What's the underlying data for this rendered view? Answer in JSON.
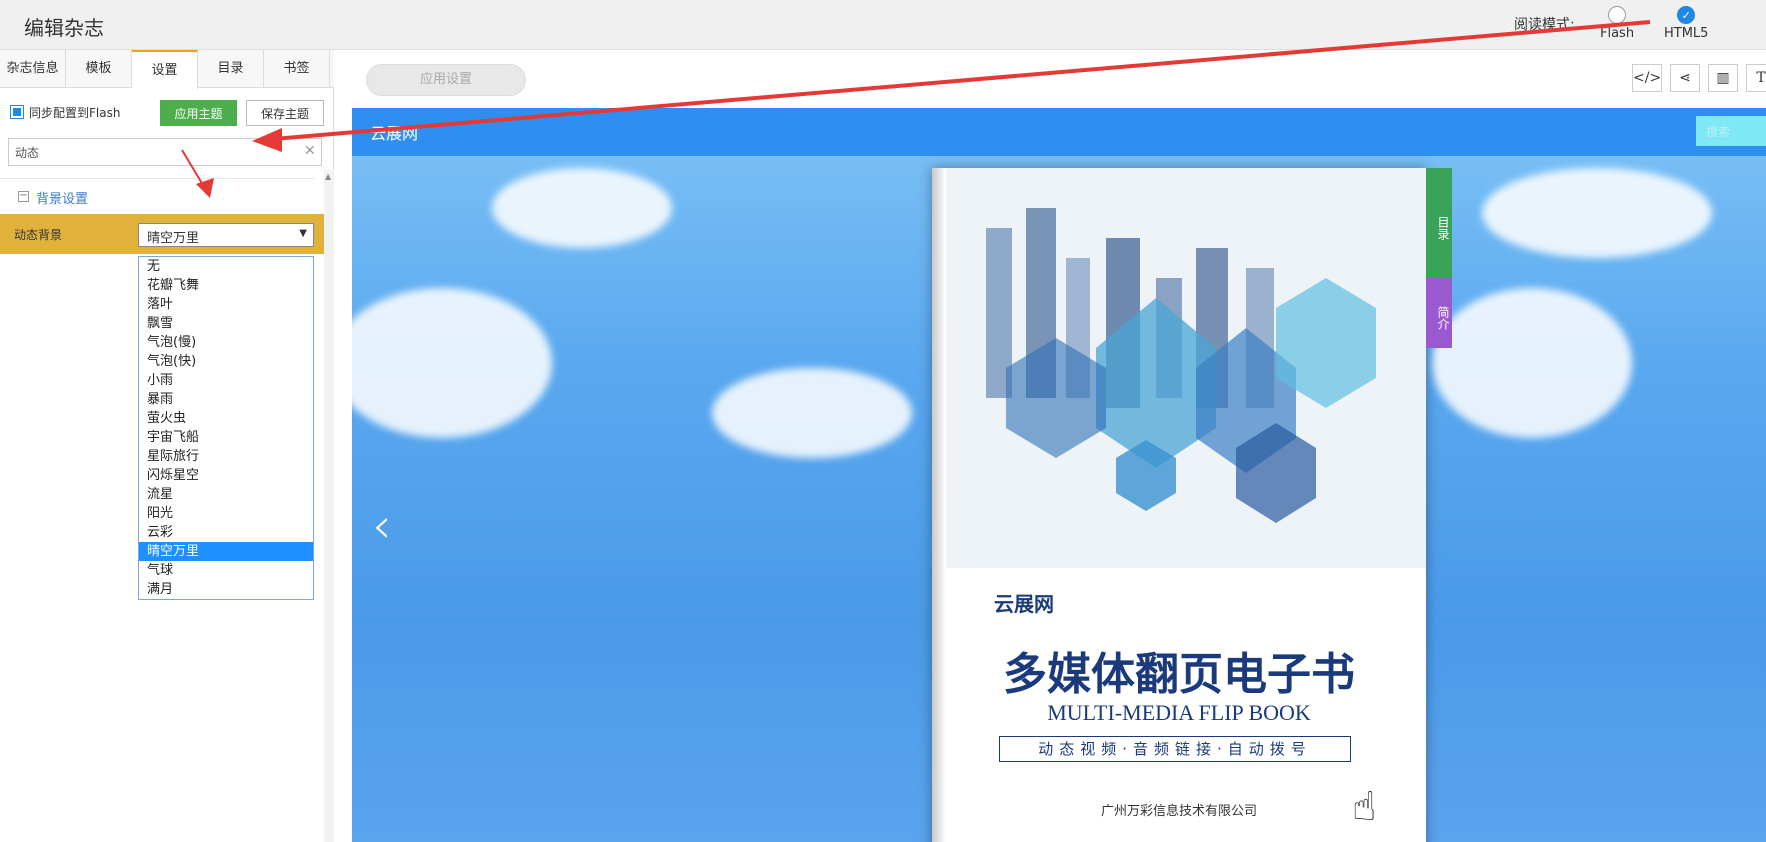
{
  "app": {
    "title": "编辑杂志"
  },
  "read_mode": {
    "label": "阅读模式:",
    "options": [
      {
        "label": "Flash",
        "selected": false
      },
      {
        "label": "HTML5",
        "selected": true
      }
    ]
  },
  "tabs": [
    "杂志信息",
    "模板",
    "设置",
    "目录",
    "书签"
  ],
  "active_tab": "设置",
  "settings": {
    "sync_label": "同步配置到Flash",
    "apply_theme": "应用主题",
    "save_theme": "保存主题",
    "search_value": "动态",
    "section_title": "背景设置",
    "prop_label": "动态背景",
    "selected_value": "晴空万里",
    "options": [
      "无",
      "花瓣飞舞",
      "落叶",
      "飘雪",
      "气泡(慢)",
      "气泡(快)",
      "小雨",
      "暴雨",
      "萤火虫",
      "宇宙飞船",
      "星际旅行",
      "闪烁星空",
      "流星",
      "阳光",
      "云彩",
      "晴空万里",
      "气球",
      "满月"
    ]
  },
  "content": {
    "apply_settings": "应用设置",
    "tool_icons": [
      "code-icon",
      "share-icon",
      "layout-icon",
      "text-icon",
      "download-icon"
    ],
    "preview": {
      "logo": "云展网",
      "search_placeholder": "搜索",
      "side_tabs": [
        "目录",
        "简介"
      ],
      "book": {
        "logo": "云展网",
        "title": "多媒体翻页电子书",
        "subtitle": "MULTI-MEDIA FLIP BOOK",
        "tagline": "动态视频·音频链接·自动拨号",
        "company": "广州万彩信息技术有限公司"
      }
    }
  },
  "colors": {
    "accent": "#1e88e5",
    "apply_button": "#4cae4c",
    "highlight_row": "#e0b23c",
    "annotation_arrow": "#e53935"
  }
}
